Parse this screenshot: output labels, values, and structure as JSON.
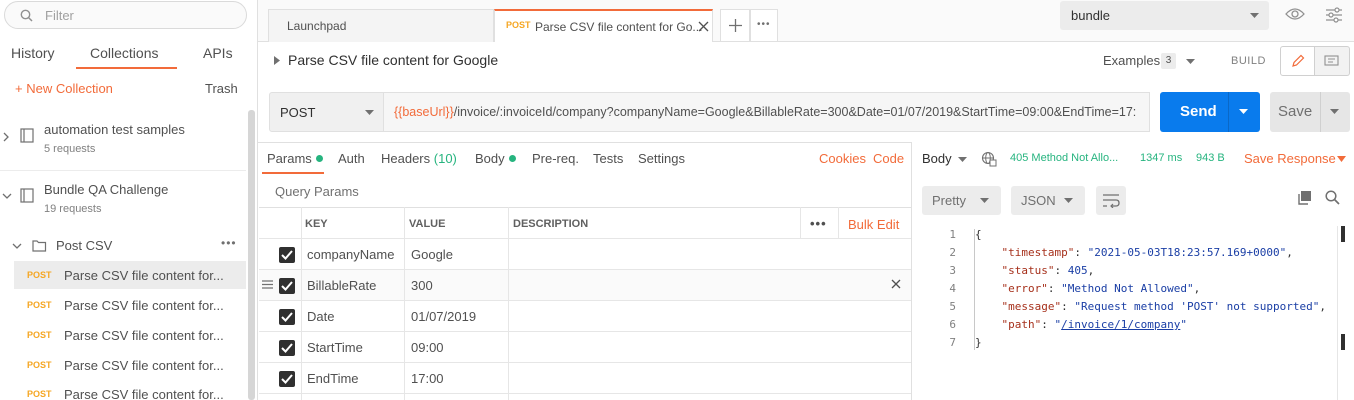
{
  "sidebar": {
    "filter_placeholder": "Filter",
    "tabs": [
      "History",
      "Collections",
      "APIs"
    ],
    "new_collection": "+ New Collection",
    "trash": "Trash",
    "collections": [
      {
        "name": "automation test samples",
        "count": "5 requests"
      },
      {
        "name": "Bundle QA Challenge",
        "count": "19 requests"
      }
    ],
    "folder": "Post CSV",
    "requests": [
      {
        "method": "POST",
        "title": "Parse CSV file content for..."
      },
      {
        "method": "POST",
        "title": "Parse CSV file content for..."
      },
      {
        "method": "POST",
        "title": "Parse CSV file content for..."
      },
      {
        "method": "POST",
        "title": "Parse CSV file content for..."
      },
      {
        "method": "POST",
        "title": "Parse CSV file content for..."
      }
    ]
  },
  "tabs": {
    "launchpad": "Launchpad",
    "active_method": "POST",
    "active_title": "Parse CSV file content for Go..."
  },
  "environment": "bundle",
  "request": {
    "name": "Parse CSV file content for Google",
    "examples_label": "Examples",
    "examples_count": "3",
    "build": "BUILD",
    "method": "POST",
    "url_var": "{{baseUrl}}",
    "url_rest": "/invoice/:invoiceId/company?companyName=Google&BillableRate=300&Date=01/07/2019&StartTime=09:00&EndTime=17:",
    "send": "Send",
    "save": "Save"
  },
  "request_tabs": {
    "params": "Params",
    "auth": "Auth",
    "headers": "Headers",
    "headers_count": "(10)",
    "body": "Body",
    "prereq": "Pre-req.",
    "tests": "Tests",
    "settings": "Settings",
    "cookies": "Cookies",
    "code": "Code"
  },
  "query_params": {
    "title": "Query Params",
    "columns": {
      "key": "KEY",
      "value": "VALUE",
      "description": "DESCRIPTION"
    },
    "bulk_edit": "Bulk Edit",
    "rows": [
      {
        "key": "companyName",
        "value": "Google"
      },
      {
        "key": "BillableRate",
        "value": "300"
      },
      {
        "key": "Date",
        "value": "01/07/2019"
      },
      {
        "key": "StartTime",
        "value": "09:00"
      },
      {
        "key": "EndTime",
        "value": "17:00"
      }
    ]
  },
  "response": {
    "body_label": "Body",
    "status": "405 Method Not Allo...",
    "time": "1347 ms",
    "size": "943 B",
    "save_response": "Save Response",
    "format": "Pretty",
    "lang": "JSON",
    "lines": [
      {
        "n": "1",
        "open": "{"
      },
      {
        "n": "2",
        "key": "\"timestamp\"",
        "val": "\"2021-05-03T18:23:57.169+0000\"",
        "comma": ","
      },
      {
        "n": "3",
        "key": "\"status\"",
        "val": "405",
        "comma": ","
      },
      {
        "n": "4",
        "key": "\"error\"",
        "val": "\"Method Not Allowed\"",
        "comma": ","
      },
      {
        "n": "5",
        "key": "\"message\"",
        "val": "\"Request method 'POST' not supported\"",
        "comma": ","
      },
      {
        "n": "6",
        "key": "\"path\"",
        "val_q1": "\"",
        "val_link": "/invoice/1/company",
        "val_q2": "\""
      },
      {
        "n": "7",
        "open": "}"
      }
    ]
  },
  "colors": {
    "accent": "#f26b3a",
    "send_blue": "#097bed",
    "success_green": "#26b47f",
    "post_method": "#f5a623"
  }
}
